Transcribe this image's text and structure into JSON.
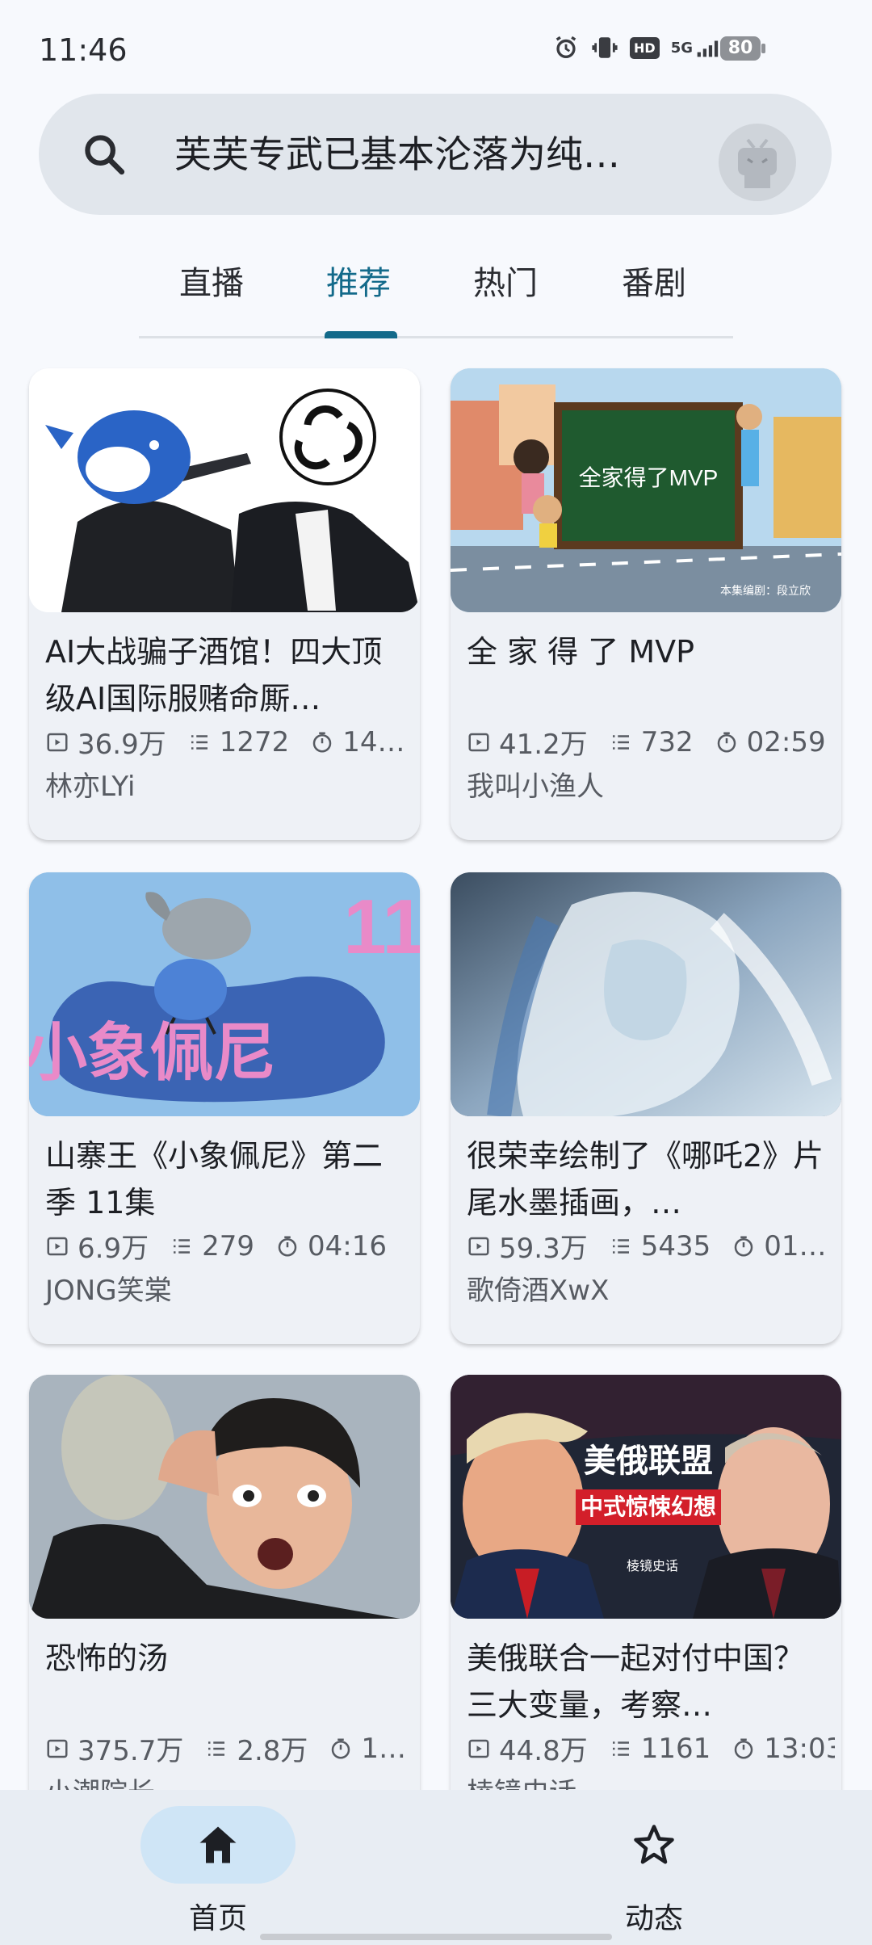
{
  "status": {
    "time": "11:46",
    "battery": "80",
    "network": "5G",
    "hd": "HD"
  },
  "search": {
    "text": "芙芙专武已基本沦落为纯…"
  },
  "tabs": [
    {
      "label": "直播",
      "active": false
    },
    {
      "label": "推荐",
      "active": true
    },
    {
      "label": "热门",
      "active": false
    },
    {
      "label": "番剧",
      "active": false
    }
  ],
  "videos": [
    {
      "title": "AI大战骗子酒馆！四大顶级AI国际服赌命厮…",
      "views": "36.9万",
      "danmaku": "1272",
      "duration": "14…",
      "author": "林亦LYi",
      "thumb_text": ""
    },
    {
      "title": "全 家 得 了 MVP",
      "views": "41.2万",
      "danmaku": "732",
      "duration": "02:59",
      "author": "我叫小渔人",
      "thumb_text": "全家得了MVP",
      "thumb_caption": "本集编剧：段立欣"
    },
    {
      "title": "山寨王《小象佩尼》第二季 11集",
      "views": "6.9万",
      "danmaku": "279",
      "duration": "04:16",
      "author": "JONG笑棠",
      "thumb_text": "小象佩尼",
      "thumb_number": "11"
    },
    {
      "title": "很荣幸绘制了《哪吒2》片尾水墨插画，…",
      "views": "59.3万",
      "danmaku": "5435",
      "duration": "01…",
      "author": "歌倚酒XwX",
      "thumb_text": ""
    },
    {
      "title": "恐怖的汤",
      "views": "375.7万",
      "danmaku": "2.8万",
      "duration": "1…",
      "author": "小潮院长",
      "thumb_text": ""
    },
    {
      "title": "美俄联合一起对付中国？三大变量，考察…",
      "views": "44.8万",
      "danmaku": "1161",
      "duration": "13:03",
      "author": "棱镜史话",
      "thumb_text": "美俄联盟",
      "thumb_subtext": "中式惊悚幻想",
      "thumb_brand": "棱镜史话"
    }
  ],
  "bottom_nav": [
    {
      "label": "首页",
      "icon": "home-icon",
      "active": true
    },
    {
      "label": "动态",
      "icon": "star-icon",
      "active": false
    }
  ],
  "colors": {
    "accent": "#136a8a",
    "background": "#f7f9fd",
    "card": "#eef1f6",
    "nav_pill": "#cfe5f6"
  }
}
